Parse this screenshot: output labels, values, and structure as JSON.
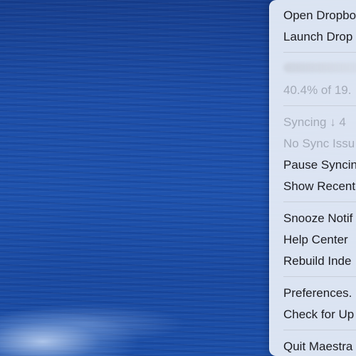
{
  "menu": {
    "items": [
      {
        "label": "Open Dropbo",
        "enabled": true
      },
      {
        "label": "Launch Drop",
        "enabled": true
      },
      {
        "label": "40.4% of 19.",
        "enabled": false
      },
      {
        "label": "Syncing ↓ 4",
        "enabled": false
      },
      {
        "label": "No Sync Issu",
        "enabled": false
      },
      {
        "label": "Pause Syncin",
        "enabled": true
      },
      {
        "label": "Show Recent",
        "enabled": true
      },
      {
        "label": "Snooze Notif",
        "enabled": true
      },
      {
        "label": "Help Center",
        "enabled": true
      },
      {
        "label": "Rebuild Inde",
        "enabled": true
      },
      {
        "label": "Preferences.",
        "enabled": true
      },
      {
        "label": "Check for Up",
        "enabled": true
      },
      {
        "label": "Quit Maestra",
        "enabled": true
      }
    ]
  }
}
